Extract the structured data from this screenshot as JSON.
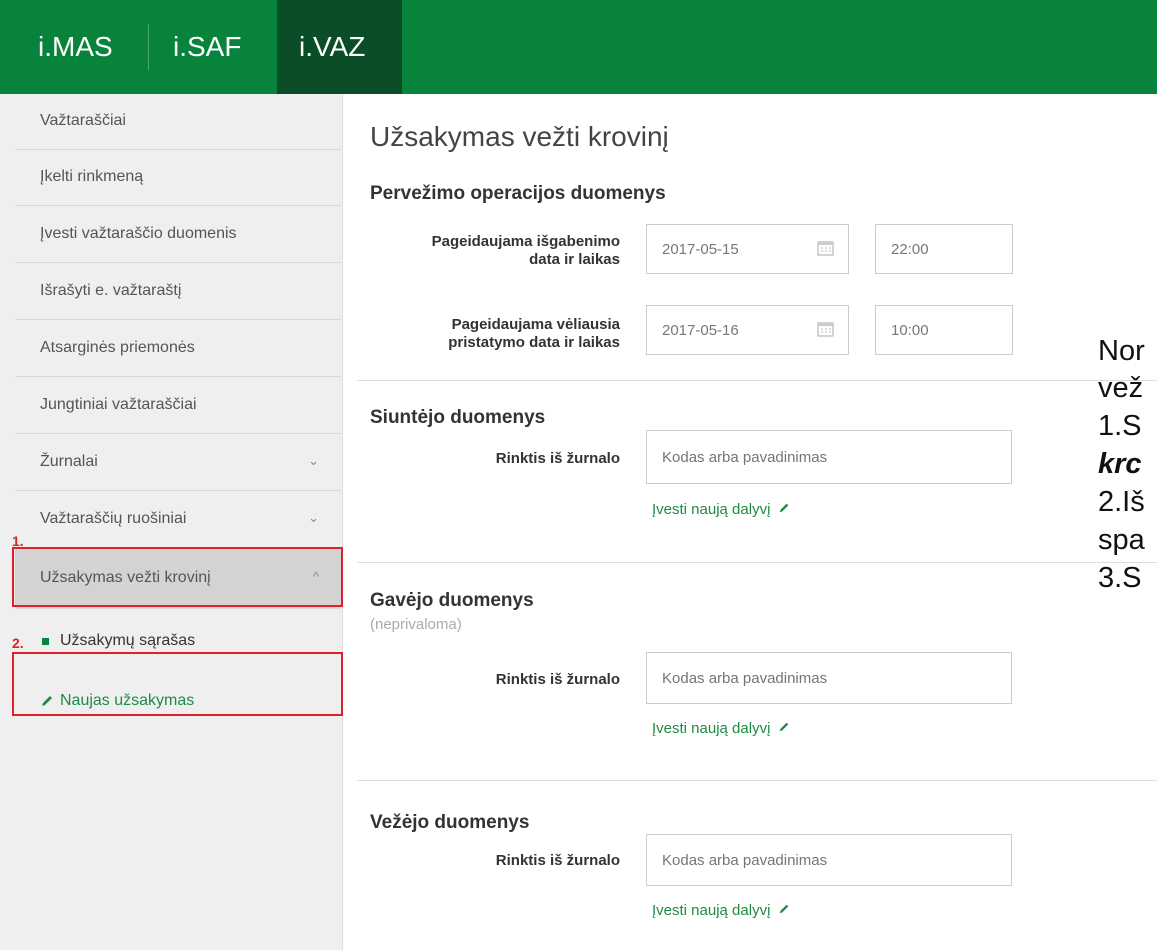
{
  "topbar": {
    "tabs": [
      {
        "label": "i.MAS"
      },
      {
        "label": "i.SAF"
      },
      {
        "label": "i.VAZ",
        "active": true
      }
    ]
  },
  "sidebar": {
    "items": [
      {
        "label": "Važtaraščiai"
      },
      {
        "label": "Įkelti rinkmeną"
      },
      {
        "label": "Įvesti važtaraščio duomenis"
      },
      {
        "label": "Išrašyti e. važtaraštį"
      },
      {
        "label": "Atsarginės priemonės"
      },
      {
        "label": "Jungtiniai važtaraščiai"
      },
      {
        "label": "Žurnalai",
        "chevron": "⌄"
      },
      {
        "label": "Važtaraščių ruošiniai",
        "chevron": "⌄"
      },
      {
        "label": "Užsakymas vežti krovinį",
        "chevron": "^"
      }
    ],
    "subitems": [
      {
        "label": "Užsakymų sąrašas",
        "icon": "square-bullet-icon"
      },
      {
        "label": "Naujas užsakymas",
        "icon": "pencil-icon"
      }
    ]
  },
  "annotations": [
    "1.",
    "2."
  ],
  "main": {
    "title": "Užsakymas vežti krovinį",
    "transport": {
      "heading": "Pervežimo operacijos duomenys",
      "rows": [
        {
          "label_line1": "Pageidaujama išgabenimo",
          "label_line2": "data ir laikas",
          "date": "2017-05-15",
          "time": "22:00"
        },
        {
          "label_line1": "Pageidaujama vėliausia",
          "label_line2": "pristatymo data ir laikas",
          "date": "2017-05-16",
          "time": "10:00"
        }
      ]
    },
    "sender": {
      "heading": "Siuntėjo duomenys",
      "field_label": "Rinktis iš žurnalo",
      "placeholder": "Kodas arba pavadinimas",
      "link": "Įvesti naują dalyvį"
    },
    "receiver": {
      "heading": "Gavėjo duomenys",
      "optional": "(neprivaloma)",
      "field_label": "Rinktis iš žurnalo",
      "placeholder": "Kodas arba pavadinimas",
      "link": "Įvesti naują dalyvį"
    },
    "carrier": {
      "heading": "Vežėjo duomenys",
      "field_label": "Rinktis iš žurnalo",
      "placeholder": "Kodas arba pavadinimas",
      "link": "Įvesti naują dalyvį"
    }
  },
  "overlay_note": {
    "lines": [
      "Nor",
      "vež",
      "1.S",
      "krc",
      "2.Iš",
      "spa",
      "3.S"
    ]
  },
  "colors": {
    "brand": "#07833c",
    "brand_dark": "#0a4d27",
    "annotation": "#e0202a",
    "link": "#1f8a44"
  }
}
